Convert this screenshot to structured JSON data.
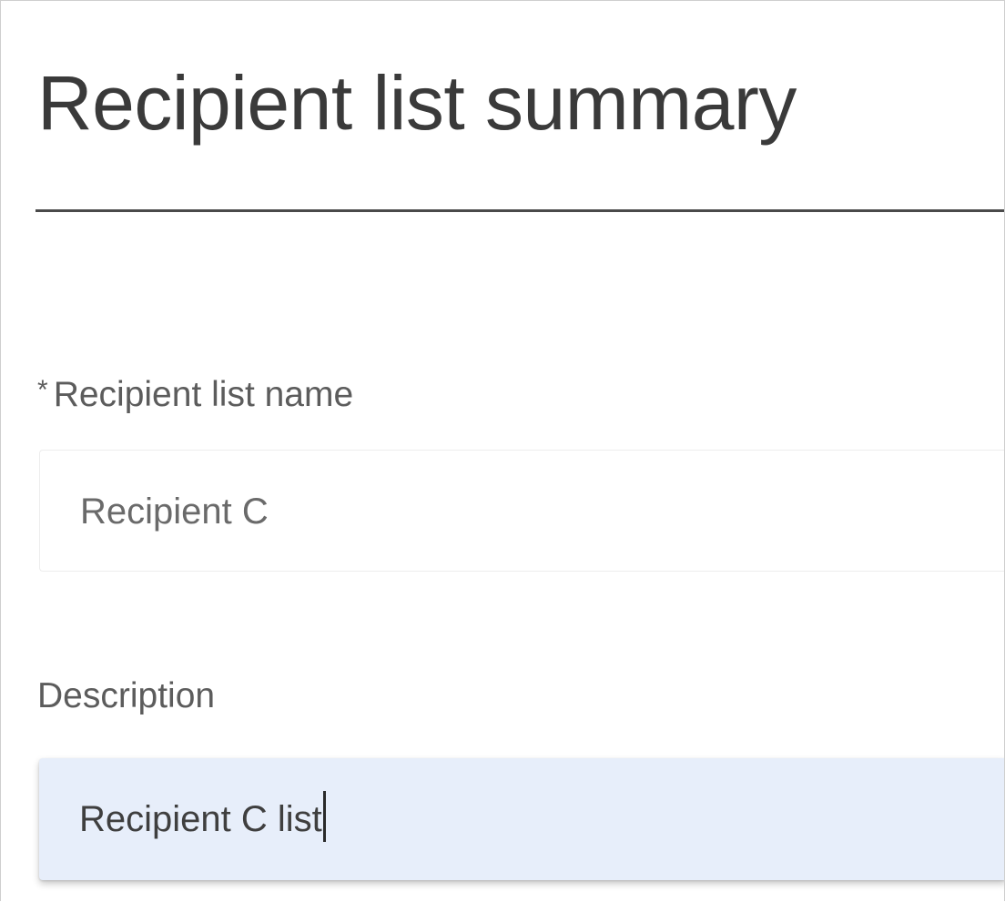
{
  "header": {
    "title": "Recipient list summary"
  },
  "form": {
    "name_field": {
      "required_mark": "*",
      "label": "Recipient list name",
      "value": "Recipient C"
    },
    "description_field": {
      "label": "Description",
      "value": "Recipient C list",
      "focused": true
    }
  },
  "colors": {
    "focused_field_background": "#e7eefa",
    "title_text": "#3a3a3a",
    "divider": "#4a4a4a"
  }
}
